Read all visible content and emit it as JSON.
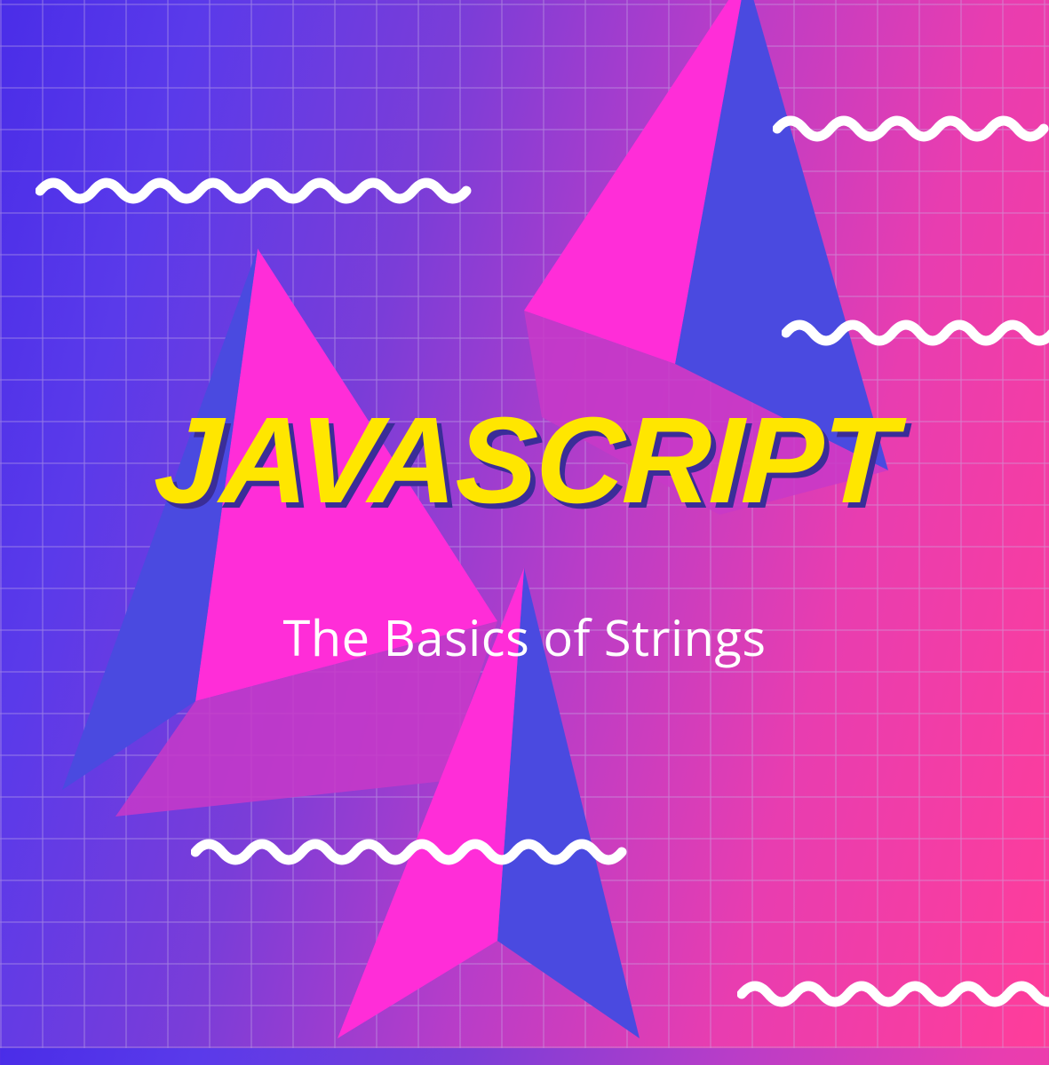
{
  "title": "JAVASCRIPT",
  "subtitle": "The Basics of Strings",
  "colors": {
    "title_fill": "#ffe600",
    "title_shadow": "#3a2d98",
    "subtitle": "#ffffff",
    "pyramid_magenta": "#ff2dd8",
    "pyramid_blue": "#4a4ae0",
    "wavy": "#ffffff"
  }
}
